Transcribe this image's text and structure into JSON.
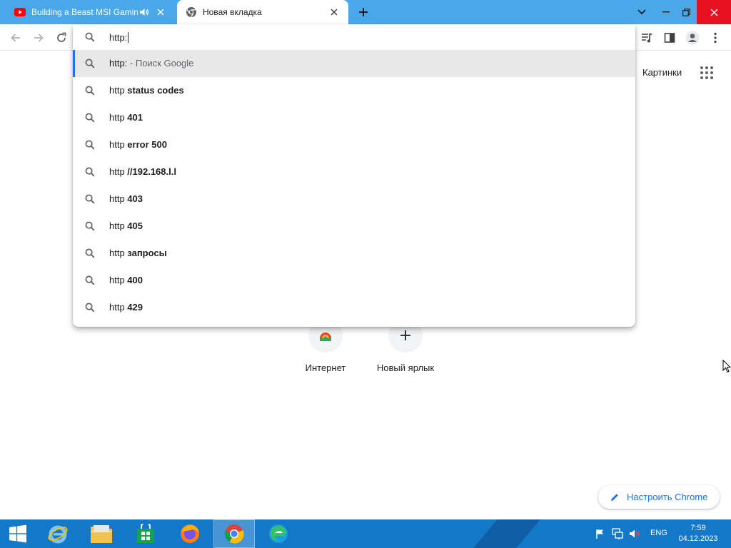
{
  "tabs": [
    {
      "title": "Building a Beast MSI Gaming",
      "active": false,
      "audio": true
    },
    {
      "title": "Новая вкладка",
      "active": true,
      "audio": false
    }
  ],
  "omnibox": {
    "query": "http:",
    "suggestions": [
      {
        "prefix": "http:",
        "bold": "",
        "suffix": " - Поиск Google",
        "selected": true
      },
      {
        "prefix": "http ",
        "bold": "status codes",
        "suffix": "",
        "selected": false
      },
      {
        "prefix": "http ",
        "bold": "401",
        "suffix": "",
        "selected": false
      },
      {
        "prefix": "http ",
        "bold": "error 500",
        "suffix": "",
        "selected": false
      },
      {
        "prefix": "http ",
        "bold": "//192.168.l.l",
        "suffix": "",
        "selected": false
      },
      {
        "prefix": "http ",
        "bold": "403",
        "suffix": "",
        "selected": false
      },
      {
        "prefix": "http ",
        "bold": "405",
        "suffix": "",
        "selected": false
      },
      {
        "prefix": "http ",
        "bold": "запросы",
        "suffix": "",
        "selected": false
      },
      {
        "prefix": "http ",
        "bold": "400",
        "suffix": "",
        "selected": false
      },
      {
        "prefix": "http ",
        "bold": "429",
        "suffix": "",
        "selected": false
      }
    ]
  },
  "ntp": {
    "images_link": "Картинки",
    "shortcuts": [
      {
        "label": "Интернет",
        "icon": "chrome-web-store-icon"
      },
      {
        "label": "Новый ярлык",
        "icon": "plus-icon"
      }
    ],
    "customize_label": "Настроить Chrome"
  },
  "taskbar": {
    "apps": [
      "start-button",
      "internet-explorer-icon",
      "file-explorer-icon",
      "store-icon",
      "firefox-icon",
      "chrome-icon",
      "edge-icon"
    ],
    "active_app": "chrome-icon",
    "language": "ENG",
    "time": "7:59",
    "date": "04.12.2023"
  },
  "colors": {
    "tabstrip": "#4aa8e8",
    "taskbar": "#1478c8",
    "accent": "#1a73e8",
    "close_red": "#e81123"
  }
}
